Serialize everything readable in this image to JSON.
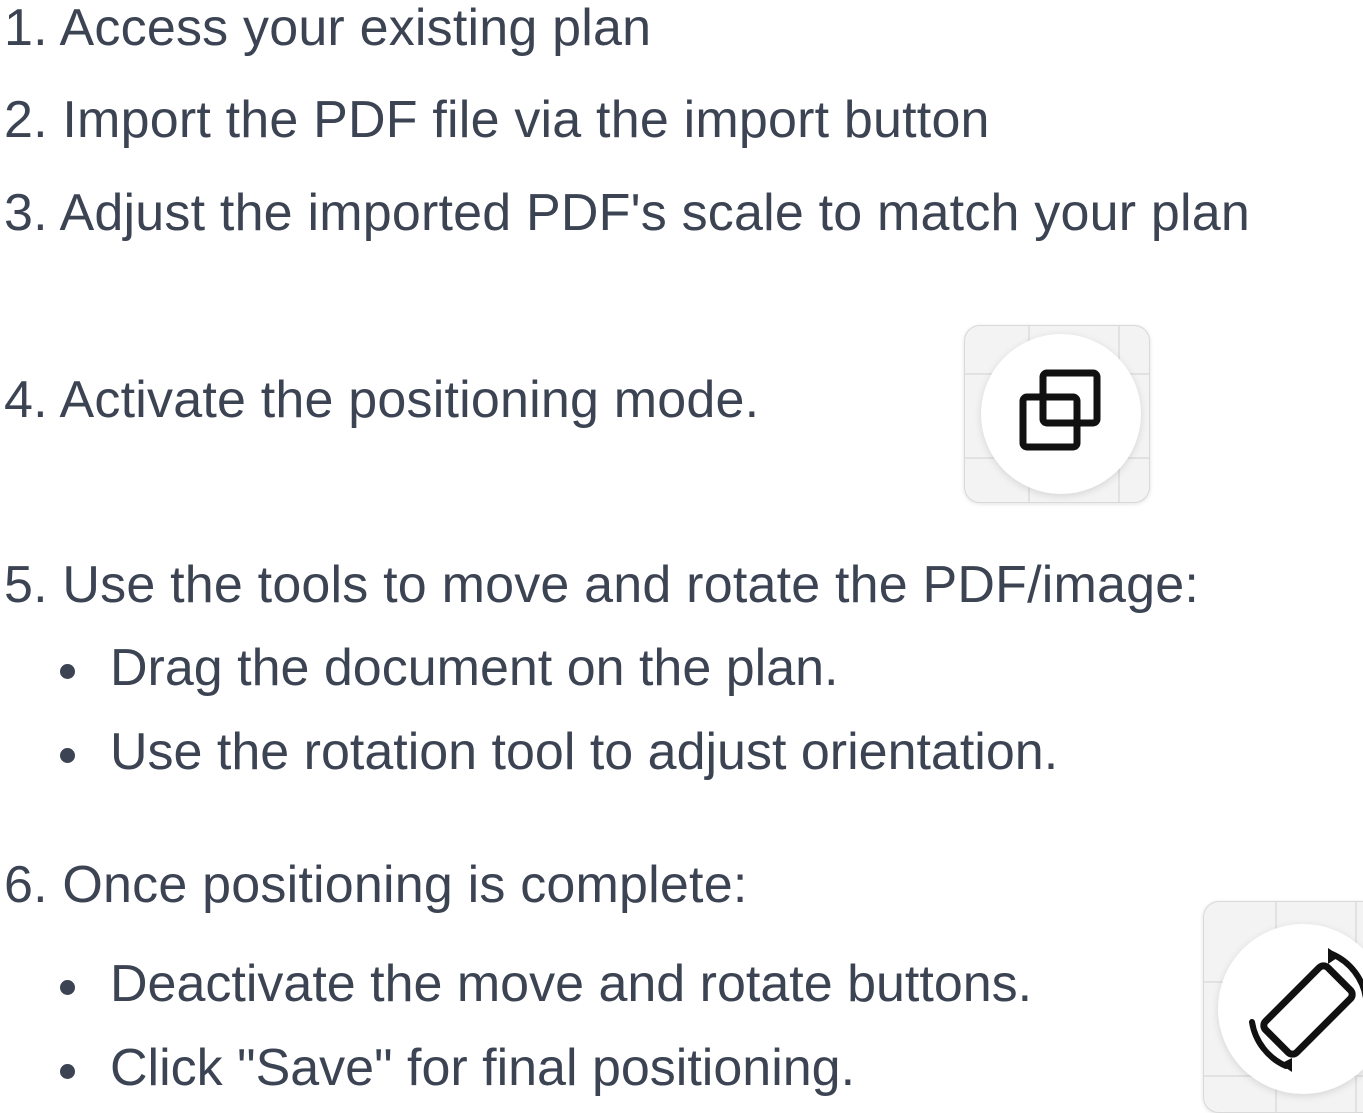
{
  "steps": {
    "s1": "1. Access your existing plan",
    "s2": "2. Import the PDF file via the import button",
    "s3": "3. Adjust the imported PDF's scale to match your plan",
    "s4": "4. Activate the positioning mode.",
    "s5": "5. Use the tools to move and rotate the PDF/image:",
    "s5_bullets": [
      "Drag the document on the plan.",
      "Use the rotation tool to adjust orientation."
    ],
    "s6": "6. Once positioning is complete:",
    "s6_bullets": [
      "Deactivate the move and rotate buttons.",
      "Click \"Save\" for final positioning."
    ]
  },
  "icons": {
    "positioning": "positioning-mode-icon",
    "rotate": "rotate-icon"
  },
  "colors": {
    "text": "#3c4453",
    "icon": "#111111"
  }
}
